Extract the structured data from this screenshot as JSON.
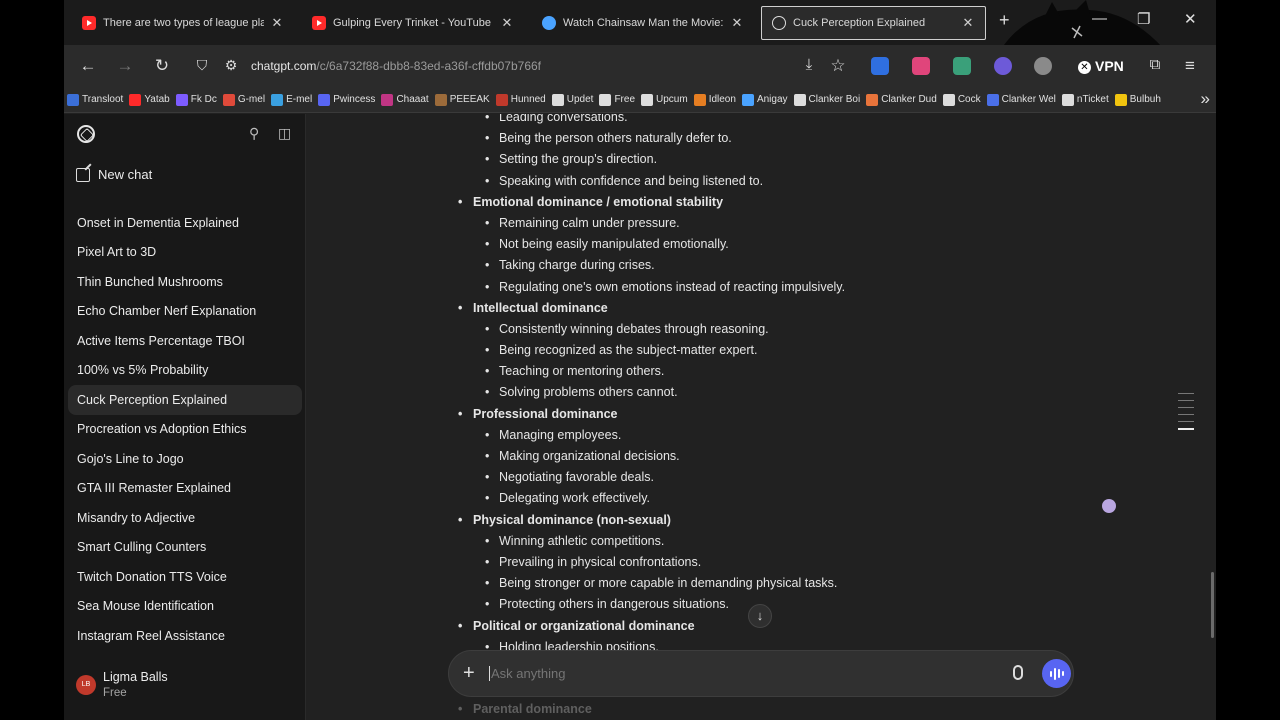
{
  "browser": {
    "tabs": [
      {
        "title": "There are two types of league players",
        "icon": "youtube-icon"
      },
      {
        "title": "Gulping Every Trinket - YouTube",
        "icon": "youtube-icon"
      },
      {
        "title": "Watch Chainsaw Man the Movie: Reze",
        "icon": "site-icon"
      },
      {
        "title": "Cuck Perception Explained",
        "icon": "chatgpt-icon",
        "active": true
      }
    ],
    "url_host": "chatgpt.com",
    "url_path": "/c/6a732f88-dbb8-83ed-a36f-cffdb07b766f",
    "vpn_label": "VPN",
    "bookmarks": [
      {
        "label": "Transloot",
        "color": "#3b6fd8"
      },
      {
        "label": "Yatab",
        "color": "#ff2a2a"
      },
      {
        "label": "Fk Dc",
        "color": "#7d5cff"
      },
      {
        "label": "G-mel",
        "color": "#e04a3a"
      },
      {
        "label": "E-mel",
        "color": "#3aa0e0"
      },
      {
        "label": "Pwincess",
        "color": "#5865f2"
      },
      {
        "label": "Chaaat",
        "color": "#c13584"
      },
      {
        "label": "PEEEAK",
        "color": "#9c6b3a"
      },
      {
        "label": "Hunned",
        "color": "#c0392b"
      },
      {
        "label": "Updet",
        "color": "#dddddd"
      },
      {
        "label": "Free",
        "color": "#dddddd"
      },
      {
        "label": "Upcum",
        "color": "#dddddd"
      },
      {
        "label": "Idleon",
        "color": "#e67e22"
      },
      {
        "label": "Anigay",
        "color": "#4aa3ff"
      },
      {
        "label": "Clanker Boi",
        "color": "#dddddd"
      },
      {
        "label": "Clanker Dud",
        "color": "#e8743b"
      },
      {
        "label": "Cock",
        "color": "#dddddd"
      },
      {
        "label": "Clanker Wel",
        "color": "#4a6fe8"
      },
      {
        "label": "nTicket",
        "color": "#dddddd"
      },
      {
        "label": "Bulbuh",
        "color": "#f1c40f"
      }
    ]
  },
  "sidebar": {
    "new_chat": "New chat",
    "history": [
      "Onset in Dementia Explained",
      "Pixel Art to 3D",
      "Thin Bunched Mushrooms",
      "Echo Chamber Nerf Explanation",
      "Active Items Percentage TBOI",
      "100% vs 5% Probability",
      "Cuck Perception Explained",
      "Procreation vs Adoption Ethics",
      "Gojo's Line to Jogo",
      "GTA III Remaster Explained",
      "Misandry to Adjective",
      "Smart Culling Counters",
      "Twitch Donation TTS Voice",
      "Sea Mouse Identification",
      "Instagram Reel Assistance"
    ],
    "active_index": 6,
    "user": {
      "initials": "LB",
      "name": "Ligma Balls",
      "plan": "Free"
    }
  },
  "message": {
    "blocks": [
      {
        "type": "item",
        "text": "Leading conversations."
      },
      {
        "type": "item",
        "text": "Being the person others naturally defer to."
      },
      {
        "type": "item",
        "text": "Setting the group's direction."
      },
      {
        "type": "item",
        "text": "Speaking with confidence and being listened to."
      },
      {
        "type": "section",
        "text": "Emotional dominance / emotional stability"
      },
      {
        "type": "item",
        "text": "Remaining calm under pressure."
      },
      {
        "type": "item",
        "text": "Not being easily manipulated emotionally."
      },
      {
        "type": "item",
        "text": "Taking charge during crises."
      },
      {
        "type": "item",
        "text": "Regulating one's own emotions instead of reacting impulsively."
      },
      {
        "type": "section",
        "text": "Intellectual dominance"
      },
      {
        "type": "item",
        "text": "Consistently winning debates through reasoning."
      },
      {
        "type": "item",
        "text": "Being recognized as the subject-matter expert."
      },
      {
        "type": "item",
        "text": "Teaching or mentoring others."
      },
      {
        "type": "item",
        "text": "Solving problems others cannot."
      },
      {
        "type": "section",
        "text": "Professional dominance"
      },
      {
        "type": "item",
        "text": "Managing employees."
      },
      {
        "type": "item",
        "text": "Making organizational decisions."
      },
      {
        "type": "item",
        "text": "Negotiating favorable deals."
      },
      {
        "type": "item",
        "text": "Delegating work effectively."
      },
      {
        "type": "section",
        "text": "Physical dominance (non-sexual)"
      },
      {
        "type": "item",
        "text": "Winning athletic competitions."
      },
      {
        "type": "item",
        "text": "Prevailing in physical confrontations."
      },
      {
        "type": "item",
        "text": "Being stronger or more capable in demanding physical tasks."
      },
      {
        "type": "item",
        "text": "Protecting others in dangerous situations."
      },
      {
        "type": "section",
        "text": "Political or organizational dominance"
      },
      {
        "type": "item",
        "text": "Holding leadership positions."
      }
    ],
    "below_composer": "Parental dominance"
  },
  "composer": {
    "placeholder": "Ask anything"
  }
}
